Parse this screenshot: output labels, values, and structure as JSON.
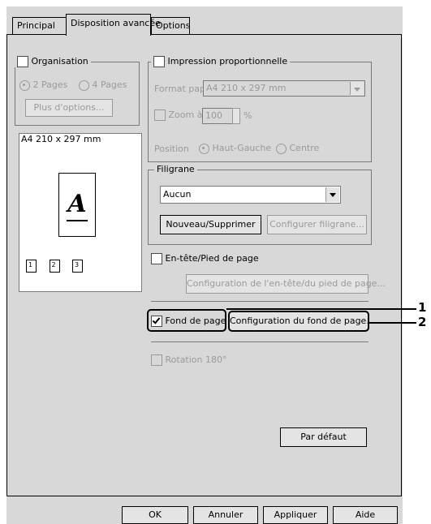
{
  "tabs": [
    "Principal",
    "Disposition avancée",
    "Options"
  ],
  "organisation": {
    "label": "Organisation",
    "radio_2": "2 Pages",
    "radio_4": "4 Pages",
    "more_button": "Plus d'options...",
    "preview_label": "A4 210 x 297 mm",
    "page_glyph": "A",
    "page_nums": [
      "1",
      "2",
      "3"
    ]
  },
  "proportional": {
    "label": "Impression proportionnelle",
    "paper_label": "Format papier",
    "paper_value": "A4 210 x 297 mm",
    "zoom_label": "Zoom à",
    "zoom_value": "100",
    "zoom_unit": "%",
    "position_label": "Position",
    "pos_top_left": "Haut-Gauche",
    "pos_center": "Centre"
  },
  "watermark": {
    "label": "Filigrane",
    "value": "Aucun",
    "new_delete": "Nouveau/Supprimer",
    "configure": "Configurer filigrane..."
  },
  "header_footer": {
    "label": "En-tête/Pied de page",
    "config": "Configuration de l'en-tête/du pied de page..."
  },
  "background": {
    "label": "Fond de page",
    "config": "Configuration du fond de page...",
    "callout_1": "1",
    "callout_2": "2"
  },
  "rotation": {
    "label": "Rotation 180°"
  },
  "default_button": "Par défaut",
  "footer_buttons": {
    "ok": "OK",
    "cancel": "Annuler",
    "apply": "Appliquer",
    "help": "Aide"
  }
}
